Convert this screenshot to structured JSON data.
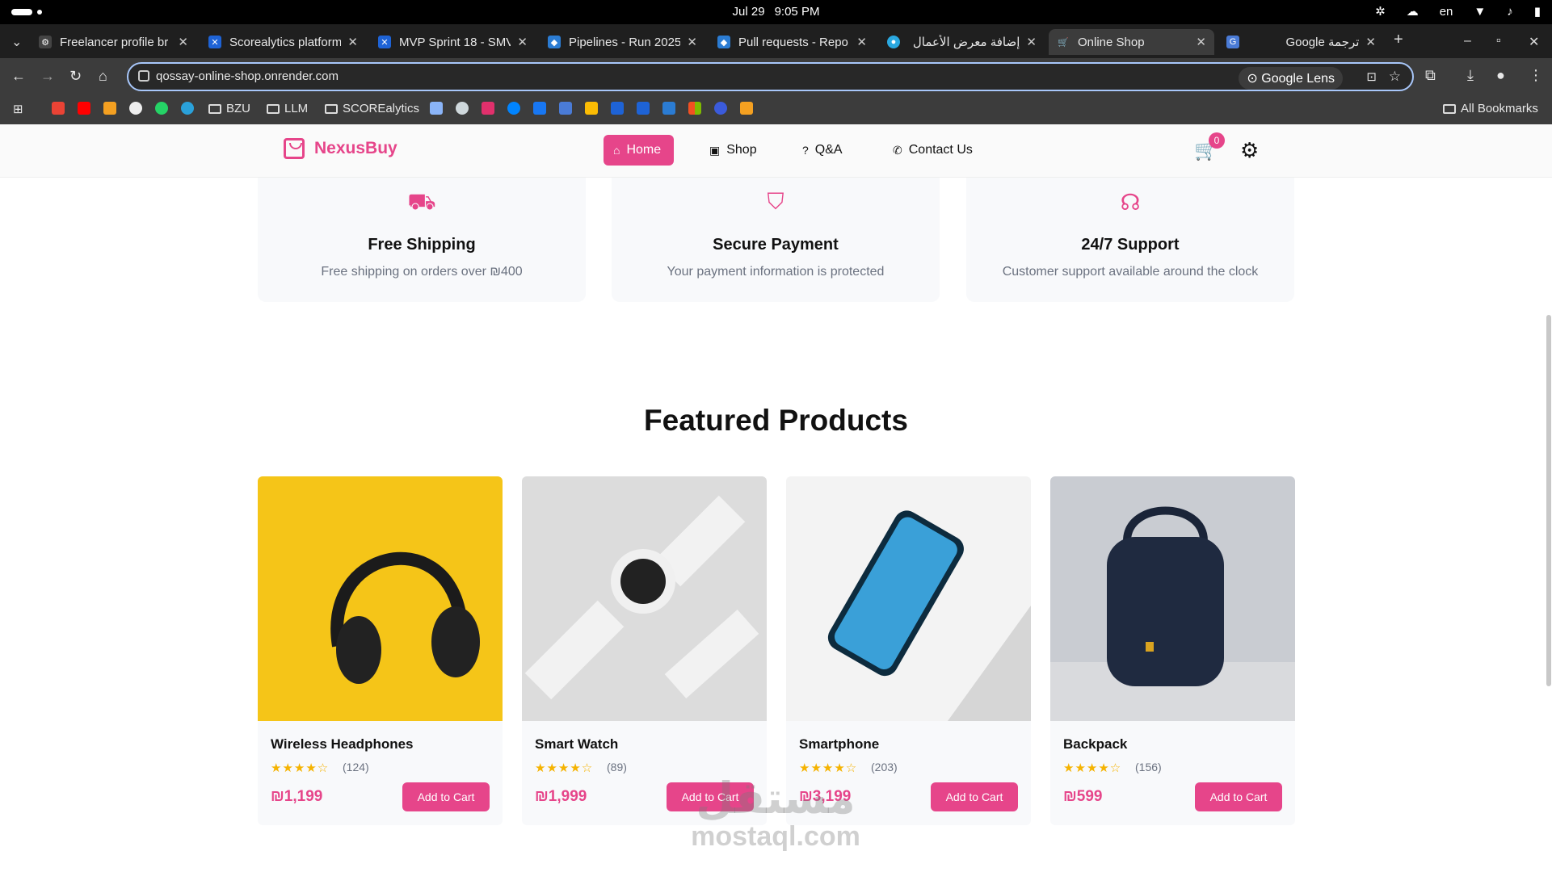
{
  "system": {
    "date": "Jul 29",
    "time": "9:05 PM",
    "lang": "en"
  },
  "tabs": [
    {
      "title": "Freelancer profile br",
      "color": "#444"
    },
    {
      "title": "Scorealytics platform",
      "color": "#1e63d6"
    },
    {
      "title": "MVP Sprint 18 - SMV",
      "color": "#1e63d6"
    },
    {
      "title": "Pipelines - Run 2025",
      "color": "#2b7cd3"
    },
    {
      "title": "Pull requests - Repo",
      "color": "#2b7cd3"
    },
    {
      "title": "إضافة معرض الأعمال",
      "color": "#2aa8e0"
    },
    {
      "title": "Online Shop",
      "color": "#4a7bd6"
    },
    {
      "title": "Google ترجمة",
      "color": "#4a7bd6"
    }
  ],
  "address": {
    "url": "qossay-online-shop.onrender.com",
    "lens": "Google Lens"
  },
  "bookmarks": {
    "items": [
      "BZU",
      "LLM",
      "SCOREalytics"
    ],
    "all": "All Bookmarks"
  },
  "site": {
    "brand": "NexusBuy",
    "nav": {
      "home": "Home",
      "shop": "Shop",
      "qa": "Q&A",
      "contact": "Contact Us"
    },
    "cart_count": "0"
  },
  "features": [
    {
      "icon": "truck-icon",
      "title": "Free Shipping",
      "desc": "Free shipping on orders over ₪400"
    },
    {
      "icon": "shield-icon",
      "title": "Secure Payment",
      "desc": "Your payment information is protected"
    },
    {
      "icon": "headphones-icon",
      "title": "24/7 Support",
      "desc": "Customer support available around the clock"
    }
  ],
  "featured_title": "Featured Products",
  "products": [
    {
      "name": "Wireless Headphones",
      "rating": 4,
      "count": "(124)",
      "price": "₪1,199",
      "cta": "Add to Cart"
    },
    {
      "name": "Smart Watch",
      "rating": 4,
      "count": "(89)",
      "price": "₪1,999",
      "cta": "Add to Cart"
    },
    {
      "name": "Smartphone",
      "rating": 4,
      "count": "(203)",
      "price": "₪3,199",
      "cta": "Add to Cart"
    },
    {
      "name": "Backpack",
      "rating": 4,
      "count": "(156)",
      "price": "₪599",
      "cta": "Add to Cart"
    }
  ],
  "watermark": {
    "line1": "مستقل",
    "line2": "mostaql.com"
  }
}
